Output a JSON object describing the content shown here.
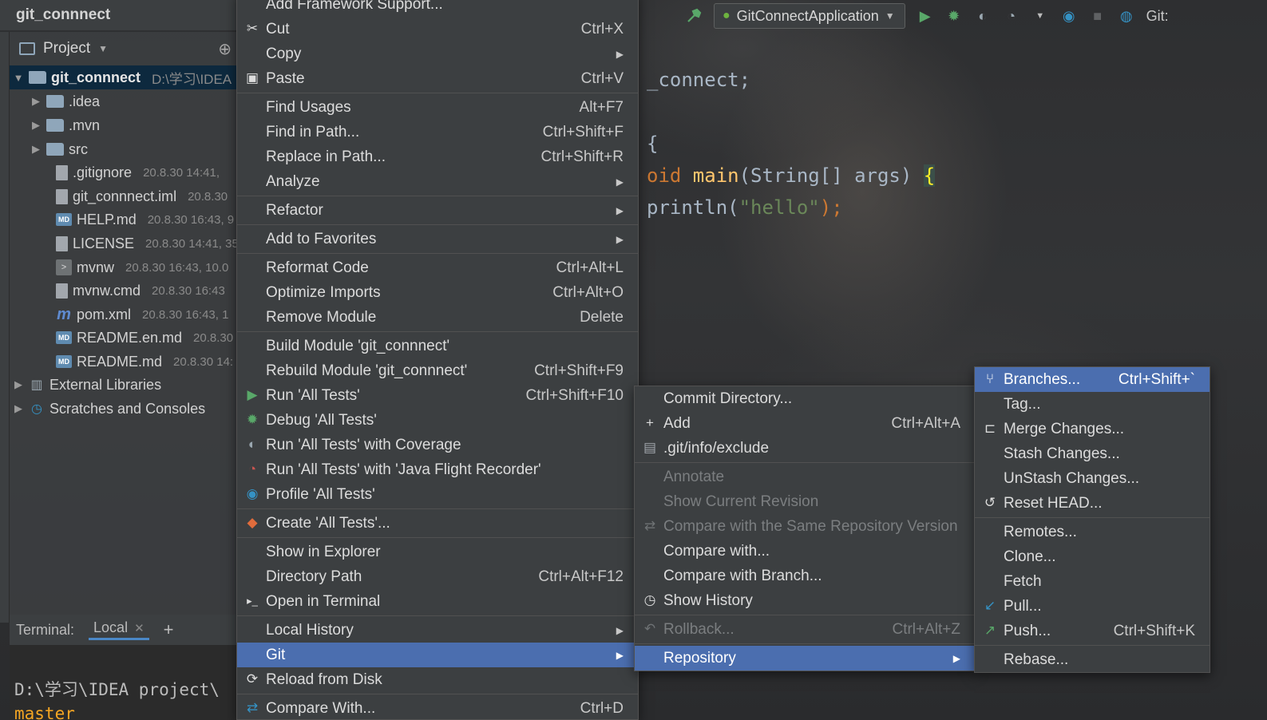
{
  "window": {
    "project_title": "git_connnect"
  },
  "toolbar": {
    "run_config": "GitConnectApplication",
    "git_label": "Git:"
  },
  "project_panel": {
    "header": "Project",
    "root": {
      "name": "git_connnect",
      "path": "D:\\学习\\IDEA"
    },
    "items": [
      {
        "name": ".idea",
        "meta": "",
        "icon": "folder-icon"
      },
      {
        "name": ".mvn",
        "meta": "",
        "icon": "folder-icon"
      },
      {
        "name": "src",
        "meta": "",
        "icon": "folder-icon"
      },
      {
        "name": ".gitignore",
        "meta": "20.8.30 14:41,",
        "icon": "file-icon"
      },
      {
        "name": "git_connnect.iml",
        "meta": "20.8.30",
        "icon": "file-icon"
      },
      {
        "name": "HELP.md",
        "meta": "20.8.30 16:43, 9",
        "icon": "markdown-icon"
      },
      {
        "name": "LICENSE",
        "meta": "20.8.30 14:41, 35",
        "icon": "file-icon"
      },
      {
        "name": "mvnw",
        "meta": "20.8.30 16:43, 10.0",
        "icon": "script-icon"
      },
      {
        "name": "mvnw.cmd",
        "meta": "20.8.30 16:43",
        "icon": "file-icon"
      },
      {
        "name": "pom.xml",
        "meta": "20.8.30 16:43, 1",
        "icon": "maven-icon"
      },
      {
        "name": "README.en.md",
        "meta": "20.8.30",
        "icon": "markdown-icon"
      },
      {
        "name": "README.md",
        "meta": "20.8.30 14:",
        "icon": "markdown-icon"
      }
    ],
    "external_libraries": "External Libraries",
    "scratches": "Scratches and Consoles"
  },
  "terminal": {
    "label": "Terminal:",
    "tab": "Local",
    "line1": "D:\\学习\\IDEA project\\",
    "line2": "master"
  },
  "editor": {
    "l1": "_connect;",
    "l2": "{",
    "l3_kw": "oid ",
    "l3_fn": "main",
    "l3_rest": "(String[] args) ",
    "l3_brace": "{",
    "l4_a": "println(",
    "l4_str": "\"hello\"",
    "l4_b": ");"
  },
  "context_menu": {
    "top_partial": "Add Framework Support...",
    "cut": "Cut",
    "cut_sc": "Ctrl+X",
    "copy": "Copy",
    "paste": "Paste",
    "paste_sc": "Ctrl+V",
    "find_usages": "Find Usages",
    "find_usages_sc": "Alt+F7",
    "find_in_path": "Find in Path...",
    "find_in_path_sc": "Ctrl+Shift+F",
    "replace_in_path": "Replace in Path...",
    "replace_in_path_sc": "Ctrl+Shift+R",
    "analyze": "Analyze",
    "refactor": "Refactor",
    "add_favorites": "Add to Favorites",
    "reformat": "Reformat Code",
    "reformat_sc": "Ctrl+Alt+L",
    "optimize": "Optimize Imports",
    "optimize_sc": "Ctrl+Alt+O",
    "remove_module": "Remove Module",
    "remove_module_sc": "Delete",
    "build_module": "Build Module 'git_connnect'",
    "rebuild_module": "Rebuild Module 'git_connnect'",
    "rebuild_module_sc": "Ctrl+Shift+F9",
    "run_tests": "Run 'All Tests'",
    "run_tests_sc": "Ctrl+Shift+F10",
    "debug_tests": "Debug 'All Tests'",
    "coverage": "Run 'All Tests' with Coverage",
    "jfr": "Run 'All Tests' with 'Java Flight Recorder'",
    "profile": "Profile 'All Tests'",
    "create_tests": "Create 'All Tests'...",
    "show_explorer": "Show in Explorer",
    "dir_path": "Directory Path",
    "dir_path_sc": "Ctrl+Alt+F12",
    "open_terminal": "Open in Terminal",
    "local_history": "Local History",
    "git": "Git",
    "reload": "Reload from Disk",
    "compare_with": "Compare With...",
    "compare_with_sc": "Ctrl+D"
  },
  "git_menu": {
    "commit_dir": "Commit Directory...",
    "add": "Add",
    "add_sc": "Ctrl+Alt+A",
    "exclude": ".git/info/exclude",
    "annotate": "Annotate",
    "show_current_rev": "Show Current Revision",
    "compare_same_repo": "Compare with the Same Repository Version",
    "compare_with": "Compare with...",
    "compare_branch": "Compare with Branch...",
    "show_history": "Show History",
    "rollback": "Rollback...",
    "rollback_sc": "Ctrl+Alt+Z",
    "repository": "Repository"
  },
  "repo_menu": {
    "branches": "Branches...",
    "branches_sc": "Ctrl+Shift+`",
    "tag": "Tag...",
    "merge": "Merge Changes...",
    "stash": "Stash Changes...",
    "unstash": "UnStash Changes...",
    "reset_head": "Reset HEAD...",
    "remotes": "Remotes...",
    "clone": "Clone...",
    "fetch": "Fetch",
    "pull": "Pull...",
    "push": "Push...",
    "push_sc": "Ctrl+Shift+K",
    "rebase": "Rebase..."
  }
}
